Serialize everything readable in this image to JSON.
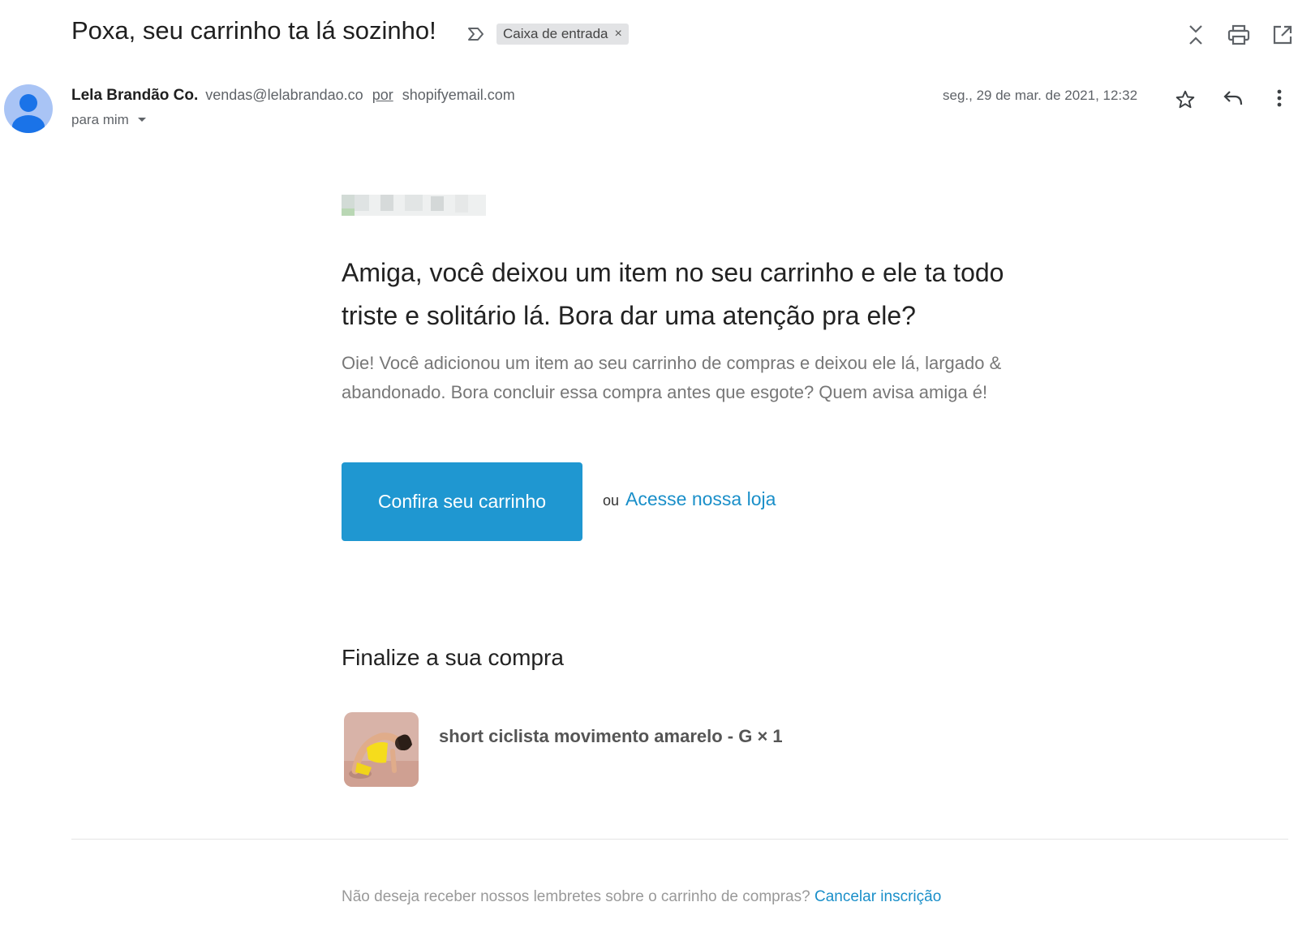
{
  "header": {
    "subject": "Poxa, seu carrinho ta lá sozinho!",
    "label_chip": "Caixa de entrada",
    "label_chip_remove": "×"
  },
  "sender": {
    "name": "Lela Brandão Co.",
    "email": "vendas@lelabrandao.co",
    "via_word": "por",
    "via_domain": "shopifyemail.com",
    "recipient": "para mim",
    "date": "seg., 29 de mar. de 2021, 12:32"
  },
  "body": {
    "headline": "Amiga, você deixou um item no seu carrinho e ele ta todo triste e solitário lá. Bora dar uma atenção pra ele?",
    "intro": "Oie! Você adicionou um item ao seu carrinho de compras e deixou ele lá, largado & abandonado. Bora concluir essa compra antes que esgote? Quem avisa amiga é!",
    "cta_label": "Confira seu carrinho",
    "or_word": "ou",
    "store_link": "Acesse nossa loja",
    "section_title": "Finalize a sua compra",
    "product": {
      "name": "short ciclista movimento amarelo - G × 1"
    }
  },
  "footer": {
    "text": "Não deseja receber nossos lembretes sobre o carrinho de compras?",
    "unsubscribe_link": "Cancelar inscrição"
  },
  "colors": {
    "accent": "#1f97d1",
    "link": "#1a8fc9",
    "chip_bg": "#e2e3e5",
    "avatar": "#a9c4f5"
  }
}
